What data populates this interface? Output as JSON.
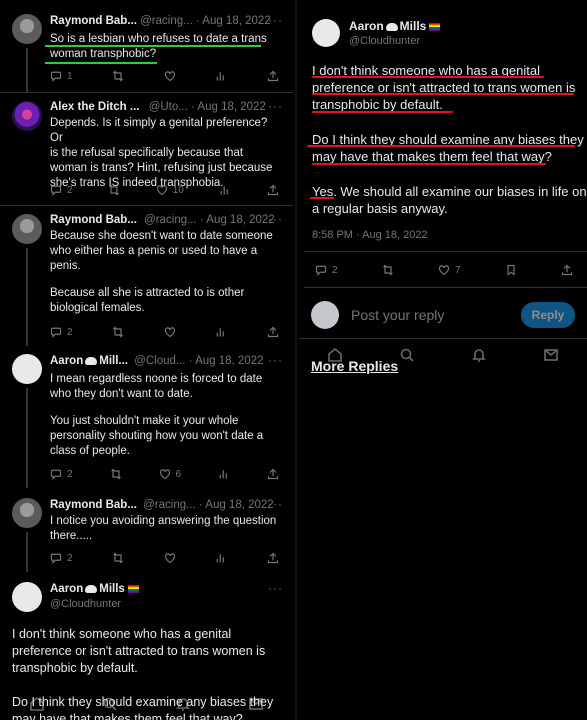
{
  "left_thread": {
    "tweets": [
      {
        "name": "Raymond Bab...",
        "meta": "@racing... · Aug 18, 2022",
        "lines": [
          "So is a lesbian who refuses to date a trans",
          "woman transphobic?"
        ],
        "replies": "1",
        "retweets": "",
        "likes": ""
      },
      {
        "name": "Alex the Ditch ...",
        "meta": "@Uto... · Aug 18, 2022",
        "lines": [
          "Depends. Is it simply a genital preference? Or",
          "is the refusal specifically because that",
          "woman is trans? Hint, refusing just because",
          "she's trans IS indeed transphobia."
        ],
        "replies": "2",
        "retweets": "",
        "likes": "10"
      },
      {
        "name": "Raymond Bab...",
        "meta": "@racing... · Aug 18, 2022",
        "lines": [
          "Because she doesn't want to date someone",
          "who either has a penis or used to have a",
          "penis.",
          "",
          "Because all she is attracted to is other",
          "biological females."
        ],
        "replies": "2",
        "retweets": "",
        "likes": ""
      },
      {
        "name": "Aaron",
        "name2": "Mill...",
        "meta": "@Cloud... · Aug 18, 2022",
        "lines": [
          "I mean regardless noone is forced to date",
          "who they don't want to date.",
          "",
          "You just shouldn't make it your whole",
          "personality shouting how you won't date a",
          "class of people."
        ],
        "replies": "2",
        "retweets": "",
        "likes": "6"
      },
      {
        "name": "Raymond Bab...",
        "meta": "@racing... · Aug 18, 2022",
        "lines": [
          "I notice you avoiding answering the question",
          "there....."
        ],
        "replies": "2",
        "retweets": "",
        "likes": ""
      }
    ],
    "focus": {
      "name": "Aaron",
      "name2": "Mills",
      "handle": "@Cloudhunter",
      "lines": [
        "I don't think someone who has a genital",
        "preference or isn't attracted to trans women is",
        "transphobic by default.",
        "",
        "Do I think they should examine any biases they",
        "may have that makes them feel that way?"
      ]
    }
  },
  "right_panel": {
    "name": "Aaron",
    "name2": "Mills",
    "handle": "@Cloudhunter",
    "p1": [
      "I don't think someone who has a genital",
      "preference or isn't attracted to trans women is",
      "transphobic by default."
    ],
    "p2": [
      "Do I think they should examine any biases they",
      "may have that makes them feel that way?"
    ],
    "p3": [
      "Yes. We should all examine our biases in life on",
      "a regular basis anyway."
    ],
    "timestamp": "8:58 PM · Aug 18, 2022",
    "replies": "2",
    "likes": "7",
    "reply_placeholder": "Post your reply",
    "reply_button": "Reply",
    "more_replies": "More Replies"
  },
  "colors": {
    "background": "#000000",
    "text": "#e7e9ea",
    "muted": "#71767b",
    "accent": "#1d9bf0",
    "green_underline": "#2ecc40",
    "red_underline": "#e0141e"
  },
  "icons": [
    "reply-icon",
    "retweet-icon",
    "like-icon",
    "views-icon",
    "share-icon",
    "bookmark-icon",
    "more-icon",
    "home-icon",
    "search-icon",
    "notifications-icon",
    "messages-icon"
  ]
}
